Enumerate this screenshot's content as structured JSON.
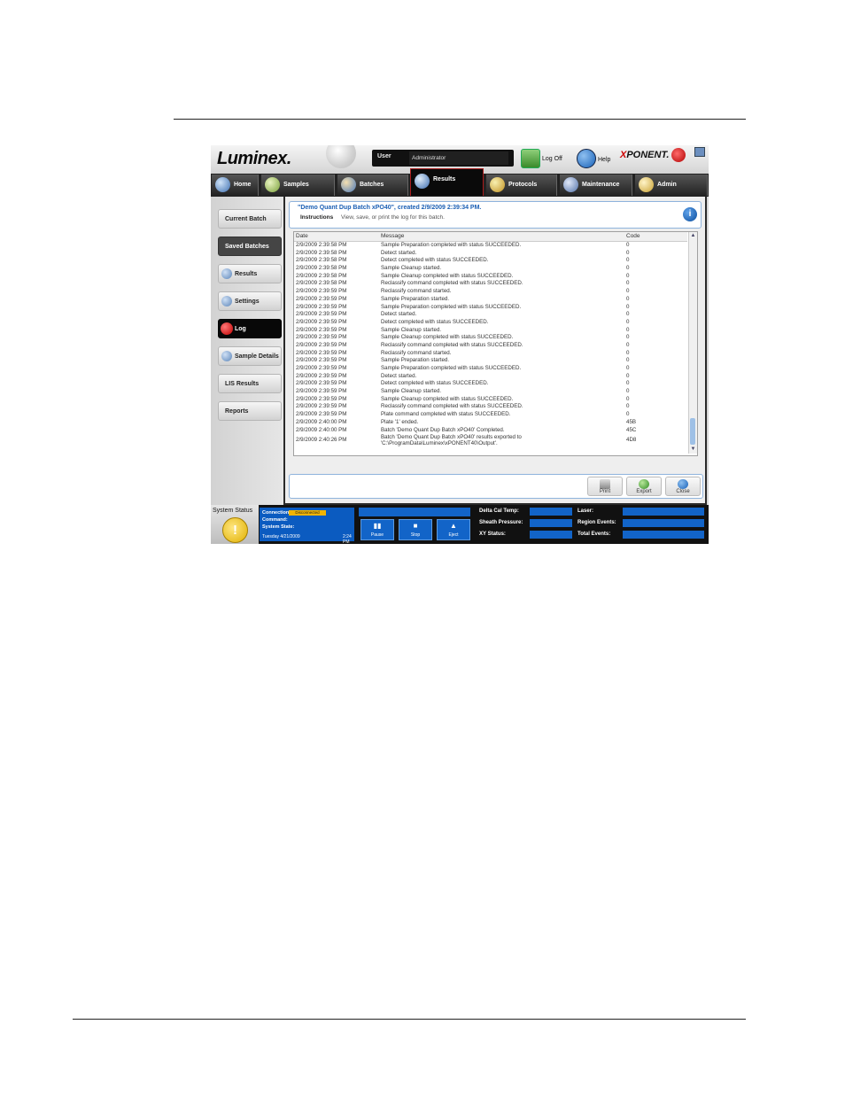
{
  "app": {
    "logo": "Luminex.",
    "user_label": "User",
    "user_value": "Administrator",
    "logoff_label": "Log Off",
    "help_label": "Help",
    "brand_x": "X",
    "brand_rest": "PONENT."
  },
  "tabs": [
    {
      "label": "Home"
    },
    {
      "label": "Samples"
    },
    {
      "label": "Batches"
    },
    {
      "label": "Results"
    },
    {
      "label": "Protocols"
    },
    {
      "label": "Maintenance"
    },
    {
      "label": "Admin"
    }
  ],
  "sidebar": {
    "items": [
      {
        "label": "Current Batch"
      },
      {
        "label": "Saved Batches"
      },
      {
        "label": "Results"
      },
      {
        "label": "Settings"
      },
      {
        "label": "Log"
      },
      {
        "label": "Sample Details"
      },
      {
        "label": "LIS Results"
      },
      {
        "label": "Reports"
      }
    ]
  },
  "main": {
    "batch_title": "\"Demo Quant Dup Batch xPO40\", created 2/9/2009 2:39:34 PM.",
    "instructions_label": "Instructions",
    "instructions_text": "View, save, or print the log for this batch.",
    "info_glyph": "i",
    "log": {
      "headers": {
        "date": "Date",
        "message": "Message",
        "code": "Code"
      },
      "rows": [
        {
          "date": "2/9/2009 2:39:58 PM",
          "message": "Sample Preparation completed with status SUCCEEDED.",
          "code": "0"
        },
        {
          "date": "2/9/2009 2:39:58 PM",
          "message": "Detect started.",
          "code": "0"
        },
        {
          "date": "2/9/2009 2:39:58 PM",
          "message": "Detect completed with status SUCCEEDED.",
          "code": "0"
        },
        {
          "date": "2/9/2009 2:39:58 PM",
          "message": "Sample Cleanup started.",
          "code": "0"
        },
        {
          "date": "2/9/2009 2:39:58 PM",
          "message": "Sample Cleanup completed with status SUCCEEDED.",
          "code": "0"
        },
        {
          "date": "2/9/2009 2:39:58 PM",
          "message": "Reclassify command completed with status SUCCEEDED.",
          "code": "0"
        },
        {
          "date": "2/9/2009 2:39:59 PM",
          "message": "Reclassify command started.",
          "code": "0"
        },
        {
          "date": "2/9/2009 2:39:59 PM",
          "message": "Sample Preparation started.",
          "code": "0"
        },
        {
          "date": "2/9/2009 2:39:59 PM",
          "message": "Sample Preparation completed with status SUCCEEDED.",
          "code": "0"
        },
        {
          "date": "2/9/2009 2:39:59 PM",
          "message": "Detect started.",
          "code": "0"
        },
        {
          "date": "2/9/2009 2:39:59 PM",
          "message": "Detect completed with status SUCCEEDED.",
          "code": "0"
        },
        {
          "date": "2/9/2009 2:39:59 PM",
          "message": "Sample Cleanup started.",
          "code": "0"
        },
        {
          "date": "2/9/2009 2:39:59 PM",
          "message": "Sample Cleanup completed with status SUCCEEDED.",
          "code": "0"
        },
        {
          "date": "2/9/2009 2:39:59 PM",
          "message": "Reclassify command completed with status SUCCEEDED.",
          "code": "0"
        },
        {
          "date": "2/9/2009 2:39:59 PM",
          "message": "Reclassify command started.",
          "code": "0"
        },
        {
          "date": "2/9/2009 2:39:59 PM",
          "message": "Sample Preparation started.",
          "code": "0"
        },
        {
          "date": "2/9/2009 2:39:59 PM",
          "message": "Sample Preparation completed with status SUCCEEDED.",
          "code": "0"
        },
        {
          "date": "2/9/2009 2:39:59 PM",
          "message": "Detect started.",
          "code": "0"
        },
        {
          "date": "2/9/2009 2:39:59 PM",
          "message": "Detect completed with status SUCCEEDED.",
          "code": "0"
        },
        {
          "date": "2/9/2009 2:39:59 PM",
          "message": "Sample Cleanup started.",
          "code": "0"
        },
        {
          "date": "2/9/2009 2:39:59 PM",
          "message": "Sample Cleanup completed with status SUCCEEDED.",
          "code": "0"
        },
        {
          "date": "2/9/2009 2:39:59 PM",
          "message": "Reclassify command completed with status SUCCEEDED.",
          "code": "0"
        },
        {
          "date": "2/9/2009 2:39:59 PM",
          "message": "Plate command completed with status SUCCEEDED.",
          "code": "0"
        },
        {
          "date": "2/9/2009 2:40:00 PM",
          "message": "Plate '1' ended.",
          "code": "45B"
        },
        {
          "date": "2/9/2009 2:40:00 PM",
          "message": "Batch 'Demo Quant Dup Batch xPO40' Completed.",
          "code": "45C"
        },
        {
          "date": "2/9/2009 2:40:26 PM",
          "message": "Batch 'Demo Quant Dup Batch xPO40' results exported to",
          "message2": "'C:\\ProgramData\\Luminex\\xPONENT40\\Output'.",
          "code": "4D8"
        }
      ]
    },
    "actions": {
      "print": "Print",
      "export": "Export",
      "close": "Close"
    }
  },
  "status": {
    "system_status": "System Status",
    "warn_glyph": "!",
    "connection_label": "Connection:",
    "connection_value": "Disconnected",
    "command_label": "Command:",
    "system_state_label": "System State:",
    "date_text": "Tuesday 4/21/2009",
    "time_text": "2:24 PM",
    "controls": [
      {
        "glyph": "▮▮",
        "label": "Pause"
      },
      {
        "glyph": "■",
        "label": "Stop"
      },
      {
        "glyph": "▲",
        "label": "Eject"
      }
    ],
    "metrics": {
      "delta_cal_temp": "Delta Cal Temp:",
      "sheath_pressure": "Sheath Pressure:",
      "xy_status": "XY Status:",
      "laser": "Laser:",
      "region_events": "Region Events:",
      "total_events": "Total Events:"
    }
  },
  "colors": {
    "accent_blue": "#1264c8",
    "title_blue": "#1b5fb4",
    "warning_yellow": "#f2b400",
    "active_tab_border": "#aa1c1c",
    "log_indicator_red": "#c00000"
  },
  "icons": {
    "tabs": [
      "home-icon",
      "samples-icon",
      "batches-icon",
      "results-icon",
      "protocols-icon",
      "maintenance-icon",
      "admin-icon"
    ],
    "actions": [
      "printer-icon",
      "export-icon",
      "close-icon"
    ],
    "header": [
      "logoff-icon",
      "help-icon",
      "info-icon",
      "warning-icon"
    ]
  }
}
